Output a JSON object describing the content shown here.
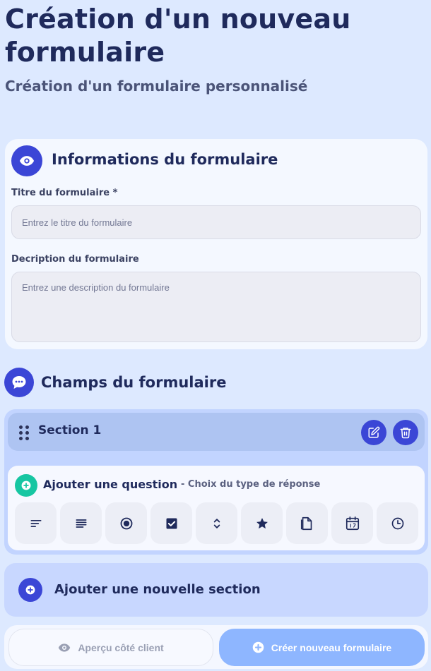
{
  "header": {
    "title": "Création d'un nouveau formulaire",
    "subtitle": "Création d'un formulaire personnalisé"
  },
  "form_info": {
    "title": "Informations du formulaire",
    "icon": "eye-icon",
    "title_label": "Titre du formulaire *",
    "title_placeholder": "Entrez le titre du formulaire",
    "title_value": "",
    "description_label": "Decription du formulaire",
    "description_placeholder": "Entrez une description du formulaire",
    "description_value": ""
  },
  "fields": {
    "title": "Champs du formulaire",
    "icon": "chat-bubble-icon",
    "sections": [
      {
        "title": "Section 1",
        "actions": [
          "edit-icon",
          "trash-icon"
        ],
        "add_question": {
          "title": "Ajouter une question",
          "subtitle": "- Choix du type de réponse",
          "types": [
            "short-text-icon",
            "long-text-icon",
            "radio-icon",
            "checkbox-icon",
            "dropdown-icon",
            "star-rating-icon",
            "file-upload-icon",
            "date-icon",
            "time-icon"
          ]
        }
      }
    ],
    "add_section_label": "Ajouter une nouvelle section"
  },
  "footer": {
    "preview_label": "Aperçu côté client",
    "create_label": "Créer nouveau formulaire"
  },
  "colors": {
    "background": "#dde9ff",
    "accent": "#3b46d6",
    "question_accent": "#17c6a2",
    "create_button": "#8eb6ff",
    "text_dark": "#1f2a5c"
  }
}
